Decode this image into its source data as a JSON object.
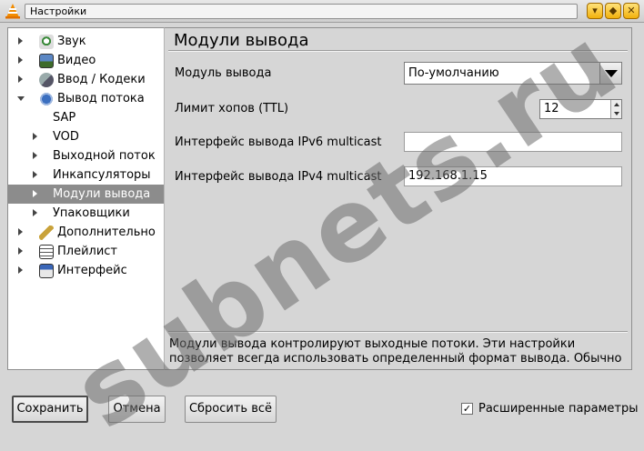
{
  "window": {
    "title": "Настройки",
    "buttons": [
      "minimize",
      "maximize",
      "close"
    ]
  },
  "tree": {
    "items": [
      {
        "label": "Звук",
        "icon": "audio-icon",
        "expander": "collapsed"
      },
      {
        "label": "Видео",
        "icon": "video-icon",
        "expander": "collapsed"
      },
      {
        "label": "Ввод / Кодеки",
        "icon": "codec-icon",
        "expander": "collapsed"
      },
      {
        "label": "Вывод потока",
        "icon": "stream-output-icon",
        "expander": "expanded"
      },
      {
        "label": "SAP",
        "expander": "none"
      },
      {
        "label": "VOD",
        "expander": "collapsed"
      },
      {
        "label": "Выходной поток",
        "expander": "collapsed"
      },
      {
        "label": "Инкапсуляторы",
        "expander": "collapsed"
      },
      {
        "label": "Модули вывода",
        "expander": "collapsed",
        "selected": true
      },
      {
        "label": "Упаковщики",
        "expander": "collapsed"
      },
      {
        "label": "Дополнительно",
        "icon": "wrench-icon",
        "expander": "collapsed"
      },
      {
        "label": "Плейлист",
        "icon": "playlist-icon",
        "expander": "collapsed"
      },
      {
        "label": "Интерфейс",
        "icon": "interface-icon",
        "expander": "collapsed"
      }
    ]
  },
  "panel": {
    "title": "Модули вывода",
    "output_module": {
      "label": "Модуль вывода",
      "value": "По-умолчанию"
    },
    "ttl": {
      "label": "Лимит хопов (TTL)",
      "value": "12"
    },
    "ipv6": {
      "label": "Интерфейс вывода IPv6 multicast",
      "value": ""
    },
    "ipv4": {
      "label": "Интерфейс вывода IPv4 multicast",
      "value": "192.168.1.15"
    },
    "description_line1": "Модули вывода контролируют выходные потоки. Эти настройки",
    "description_line2": "позволяет всегда использовать определенный формат вывода. Обычно"
  },
  "footer": {
    "save": "Сохранить",
    "cancel": "Отмена",
    "reset": "Сбросить всё",
    "advanced_label": "Расширенные параметры",
    "advanced_checked": true,
    "check_mark": "✓"
  },
  "watermark": "subnets.ru",
  "colors": {
    "selection": "#8c8c8c",
    "window_button": "#f2b10c"
  }
}
